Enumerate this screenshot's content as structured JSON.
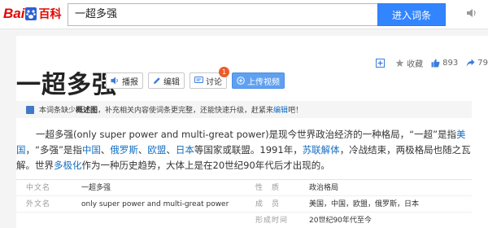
{
  "header": {
    "logo_text": "Bai",
    "logo_text_2": "百科",
    "search_value": "一超多强",
    "search_button": "进入词条"
  },
  "tools": {
    "favorite_label": "收藏",
    "like_count": "893",
    "share_count": "79"
  },
  "entry": {
    "title": "一超多强",
    "buttons": {
      "play": "播报",
      "edit": "编辑",
      "discuss": "讨论",
      "discuss_badge": "1",
      "upload_video": "上传视频"
    }
  },
  "notice": {
    "text_1": "本词条缺少",
    "bold": "概述图",
    "text_2": "，补充相关内容使词条更完整，还能快速升级，赶紧来",
    "link": "编辑",
    "text_3": "吧！"
  },
  "summary": {
    "p1": "一超多强(only super power and multi-great power)是现今世界政治经济的一种格局，“一超”是指",
    "link_us": "美国",
    "p2": "，“多强”是指",
    "link_cn": "中国",
    "p3": "、",
    "link_ru": "俄罗斯",
    "p4": "、",
    "link_eu": "欧盟",
    "p5": "、",
    "link_jp": "日本",
    "p6": "等国家或联盟。1991年，",
    "link_su": "苏联解体",
    "p7": "，冷战结束，两极格局也随之瓦解。世界",
    "link_mp": "多极化",
    "p8": "作为一种历史趋势，大体上是在20世纪90年代后才出现的。"
  },
  "info": {
    "rows": [
      {
        "k1": "中文名",
        "v1": "一超多强",
        "k2": "性　质",
        "v2": "政治格局"
      },
      {
        "k1": "外文名",
        "v1": "only super power and multi-great power",
        "k2": "成　员",
        "v2": "美国，中国，欧盟，俄罗斯，日本"
      },
      {
        "k1": "",
        "v1": "",
        "k2": "形成时间",
        "v2": "20世纪90年代至今"
      }
    ]
  },
  "colors": {
    "brand_red": "#e10601",
    "accent_blue": "#3385ff",
    "link_blue": "#136ec2"
  }
}
